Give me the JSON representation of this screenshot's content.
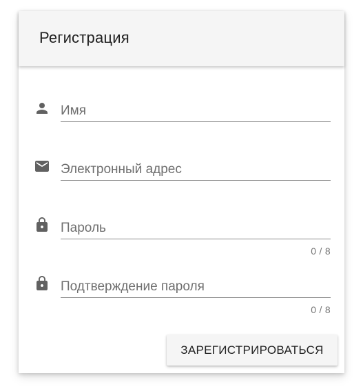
{
  "form": {
    "title": "Регистрация",
    "fields": [
      {
        "name": "name",
        "icon": "person-icon",
        "placeholder": "Имя",
        "value": "",
        "counter": ""
      },
      {
        "name": "email",
        "icon": "email-icon",
        "placeholder": "Электронный адрес",
        "value": "",
        "counter": ""
      },
      {
        "name": "password",
        "icon": "lock-icon",
        "placeholder": "Пароль",
        "value": "",
        "counter": "0 / 8"
      },
      {
        "name": "password-confirm",
        "icon": "lock-icon",
        "placeholder": "Подтверждение пароля",
        "value": "",
        "counter": "0 / 8"
      }
    ],
    "submit_label": "ЗАРЕГИСТРИРОВАТЬСЯ"
  },
  "colors": {
    "icon": "#616161",
    "header_bg": "#f5f5f5",
    "underline": "#8a8a8a",
    "placeholder": "#6f6f6f"
  }
}
